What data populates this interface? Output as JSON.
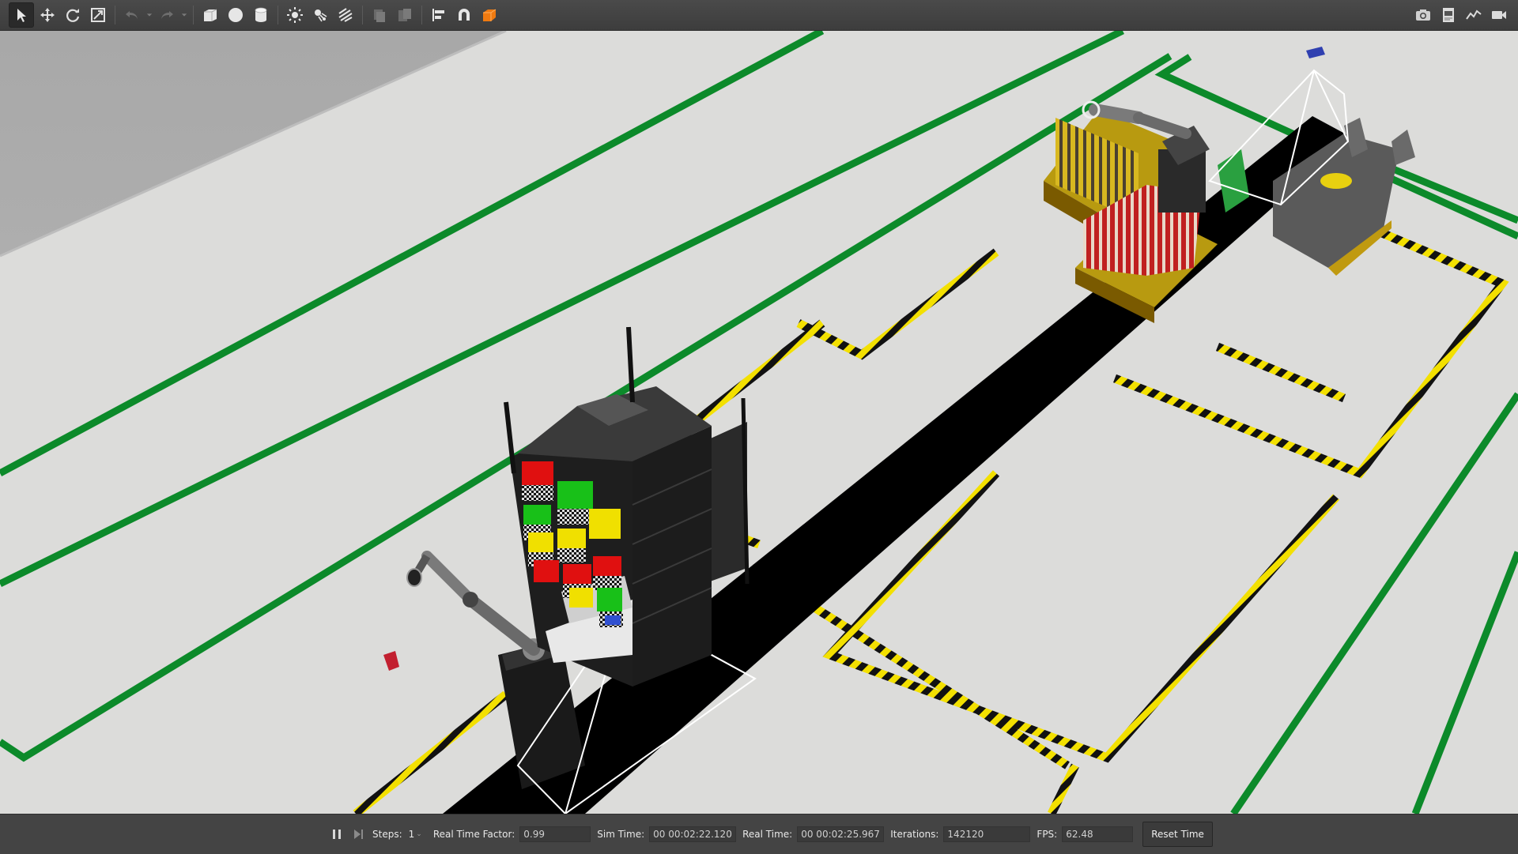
{
  "toolbar": {
    "left_tools": [
      {
        "icon": "select-arrow-icon",
        "active": true
      },
      {
        "icon": "translate-icon"
      },
      {
        "icon": "rotate-icon"
      },
      {
        "icon": "scale-icon"
      }
    ],
    "history_tools": [
      {
        "icon": "undo-icon"
      },
      {
        "icon": "redo-icon"
      }
    ],
    "shape_tools": [
      {
        "icon": "box-icon"
      },
      {
        "icon": "sphere-icon"
      },
      {
        "icon": "cylinder-icon"
      }
    ],
    "light_tools": [
      {
        "icon": "point-light-icon"
      },
      {
        "icon": "spot-light-icon"
      },
      {
        "icon": "directional-light-icon"
      }
    ],
    "edit_tools": [
      {
        "icon": "copy-icon"
      },
      {
        "icon": "paste-icon"
      },
      {
        "icon": "align-icon"
      },
      {
        "icon": "snap-icon"
      },
      {
        "icon": "view-angle-icon"
      }
    ],
    "right_tools": [
      {
        "icon": "screenshot-icon"
      },
      {
        "icon": "log-icon"
      },
      {
        "icon": "plot-icon"
      },
      {
        "icon": "video-record-icon"
      }
    ]
  },
  "status": {
    "steps_label": "Steps:",
    "steps_value": "1",
    "rtf_label": "Real Time Factor:",
    "rtf_value": "0.99",
    "sim_time_label": "Sim Time:",
    "sim_time_value": "00 00:02:22.120",
    "real_time_label": "Real Time:",
    "real_time_value": "00 00:02:25.967",
    "iterations_label": "Iterations:",
    "iterations_value": "142120",
    "fps_label": "FPS:",
    "fps_value": "62.48",
    "reset_label": "Reset Time"
  },
  "colors": {
    "floor": "#dcdcda",
    "floor_line_green": "#0c8a2a",
    "hazard_yellow": "#f3e000",
    "conveyor": "#000000",
    "shelf": "#2a2a2a",
    "box_red": "#e01010",
    "box_green": "#18c018",
    "box_yellow": "#f0e000",
    "bin_yellow": "#e0c020",
    "bin_red": "#c02020"
  }
}
